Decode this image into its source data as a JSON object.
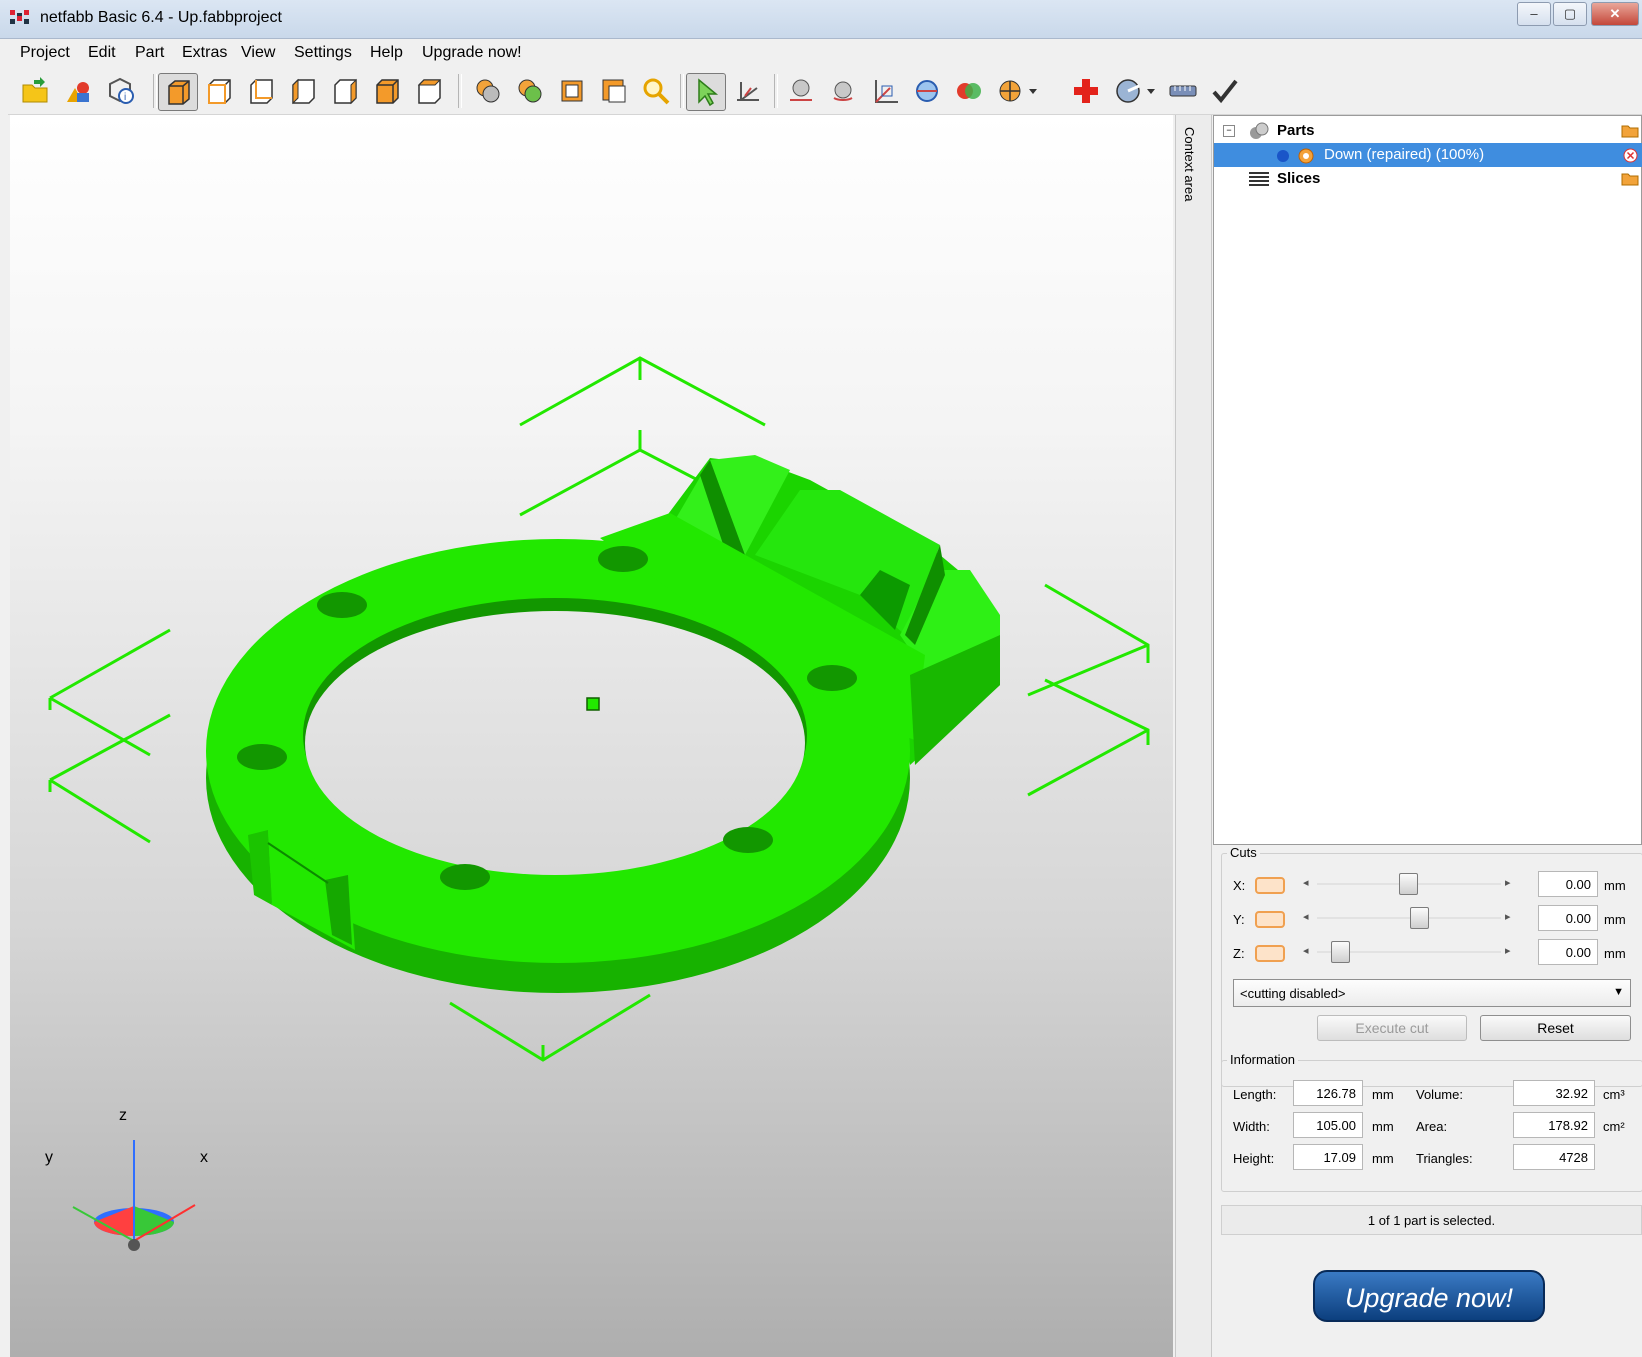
{
  "window": {
    "title": "netfabb Basic 6.4 - Up.fabbproject",
    "controls": {
      "minimize": "–",
      "maximize": "▢",
      "close": "✕"
    }
  },
  "menu": [
    "Project",
    "Edit",
    "Part",
    "Extras",
    "View",
    "Settings",
    "Help",
    "Upgrade now!"
  ],
  "toolbar": {
    "icons": [
      "open-project-icon",
      "add-part-icon",
      "part-info-icon",
      "view-iso-icon",
      "view-front-icon",
      "view-back-icon",
      "view-left-icon",
      "view-right-icon",
      "view-top-icon",
      "view-bottom-icon",
      "shading-icon",
      "color-parts-icon",
      "zoom-selection-icon",
      "zoom-all-icon",
      "zoom-icon",
      "select-icon",
      "measure-icon",
      "move-icon",
      "rotate-icon",
      "scale-icon",
      "orient-icon",
      "boolean-icon",
      "section-icon",
      "repair-icon",
      "analysis-icon",
      "ruler-icon",
      "apply-icon"
    ]
  },
  "viewport": {
    "axis_labels": {
      "z": "z",
      "y": "y",
      "x": "x"
    },
    "part_color": "#22e800",
    "background_top": "#ffffff",
    "background_bottom": "#aeaeae"
  },
  "context_area": {
    "label": "Context area"
  },
  "tree": {
    "parts_label": "Parts",
    "part_item": "Down (repaired) (100%)",
    "slices_label": "Slices",
    "selection_color": "#3f8ddf"
  },
  "cuts": {
    "title": "Cuts",
    "axes": [
      {
        "label": "X:",
        "value": "0.00",
        "unit": "mm",
        "position": 0.49
      },
      {
        "label": "Y:",
        "value": "0.00",
        "unit": "mm",
        "position": 0.55
      },
      {
        "label": "Z:",
        "value": "0.00",
        "unit": "mm",
        "position": 0.12
      }
    ],
    "mode": "<cutting disabled>",
    "execute_label": "Execute cut",
    "reset_label": "Reset"
  },
  "information": {
    "title": "Information",
    "length_label": "Length:",
    "length_value": "126.78",
    "length_unit": "mm",
    "width_label": "Width:",
    "width_value": "105.00",
    "width_unit": "mm",
    "height_label": "Height:",
    "height_value": "17.09",
    "height_unit": "mm",
    "volume_label": "Volume:",
    "volume_value": "32.92",
    "volume_unit": "cm³",
    "area_label": "Area:",
    "area_value": "178.92",
    "area_unit": "cm²",
    "triangles_label": "Triangles:",
    "triangles_value": "4728"
  },
  "status": "1 of 1 part is selected.",
  "upgrade_button": "Upgrade now!"
}
